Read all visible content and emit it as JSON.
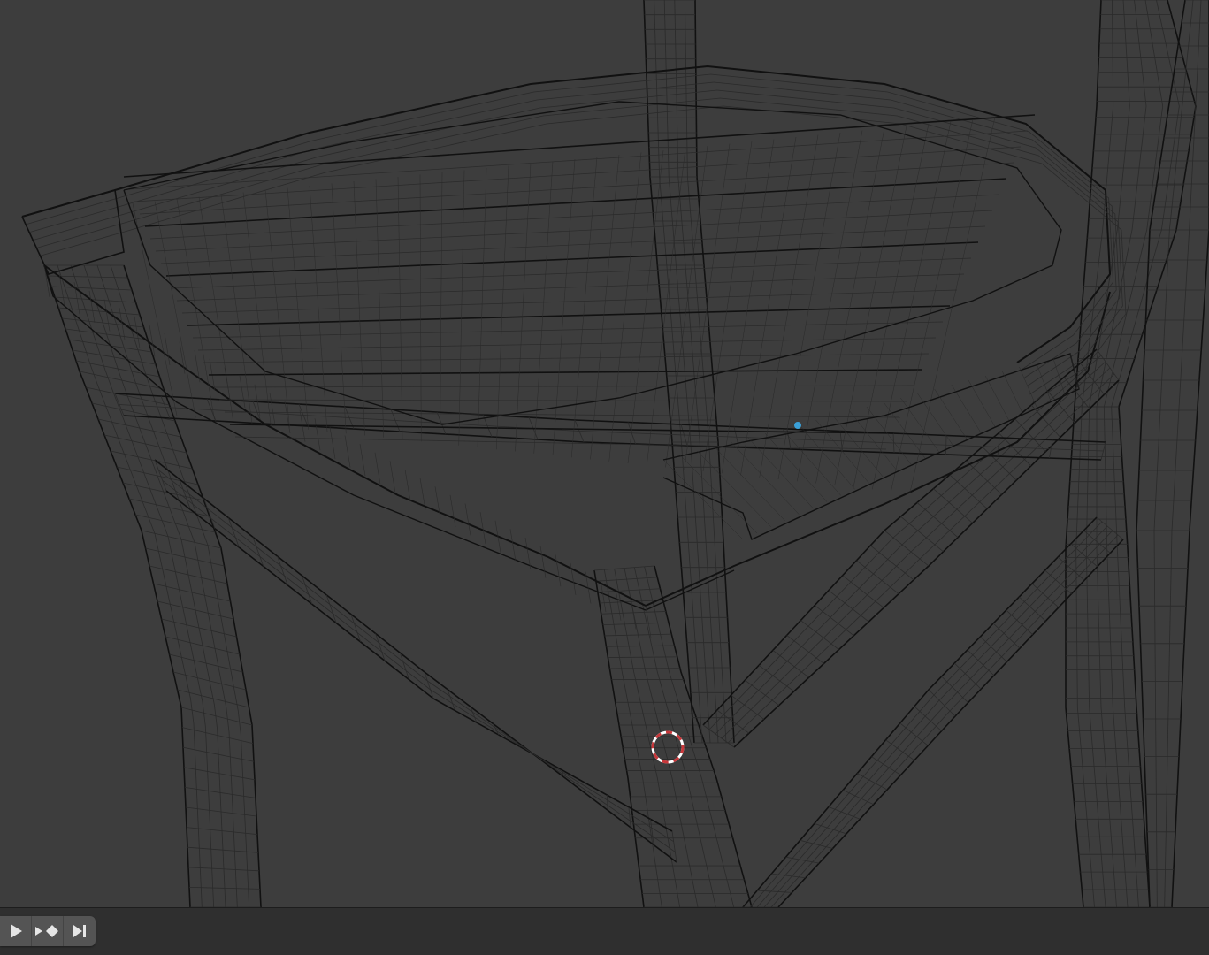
{
  "viewport": {
    "background_color": "#3d3d3d",
    "wire_color": "#111111",
    "wire_light_color": "#2a2a2a",
    "cursor_color_primary": "#c8373a",
    "cursor_color_secondary": "#ffffff",
    "selected_vertex_color": "#3aa0d8",
    "object": "chair-wireframe-mesh"
  },
  "timeline": {
    "buttons": [
      {
        "name": "play-button",
        "icon": "play-icon"
      },
      {
        "name": "jump-keyframe-button",
        "icon": "keyframe-jump-icon"
      },
      {
        "name": "jump-end-button",
        "icon": "jump-to-end-icon"
      }
    ],
    "bar_color": "#2f2f2f",
    "button_color": "#545454",
    "icon_color": "#e6e6e6"
  }
}
